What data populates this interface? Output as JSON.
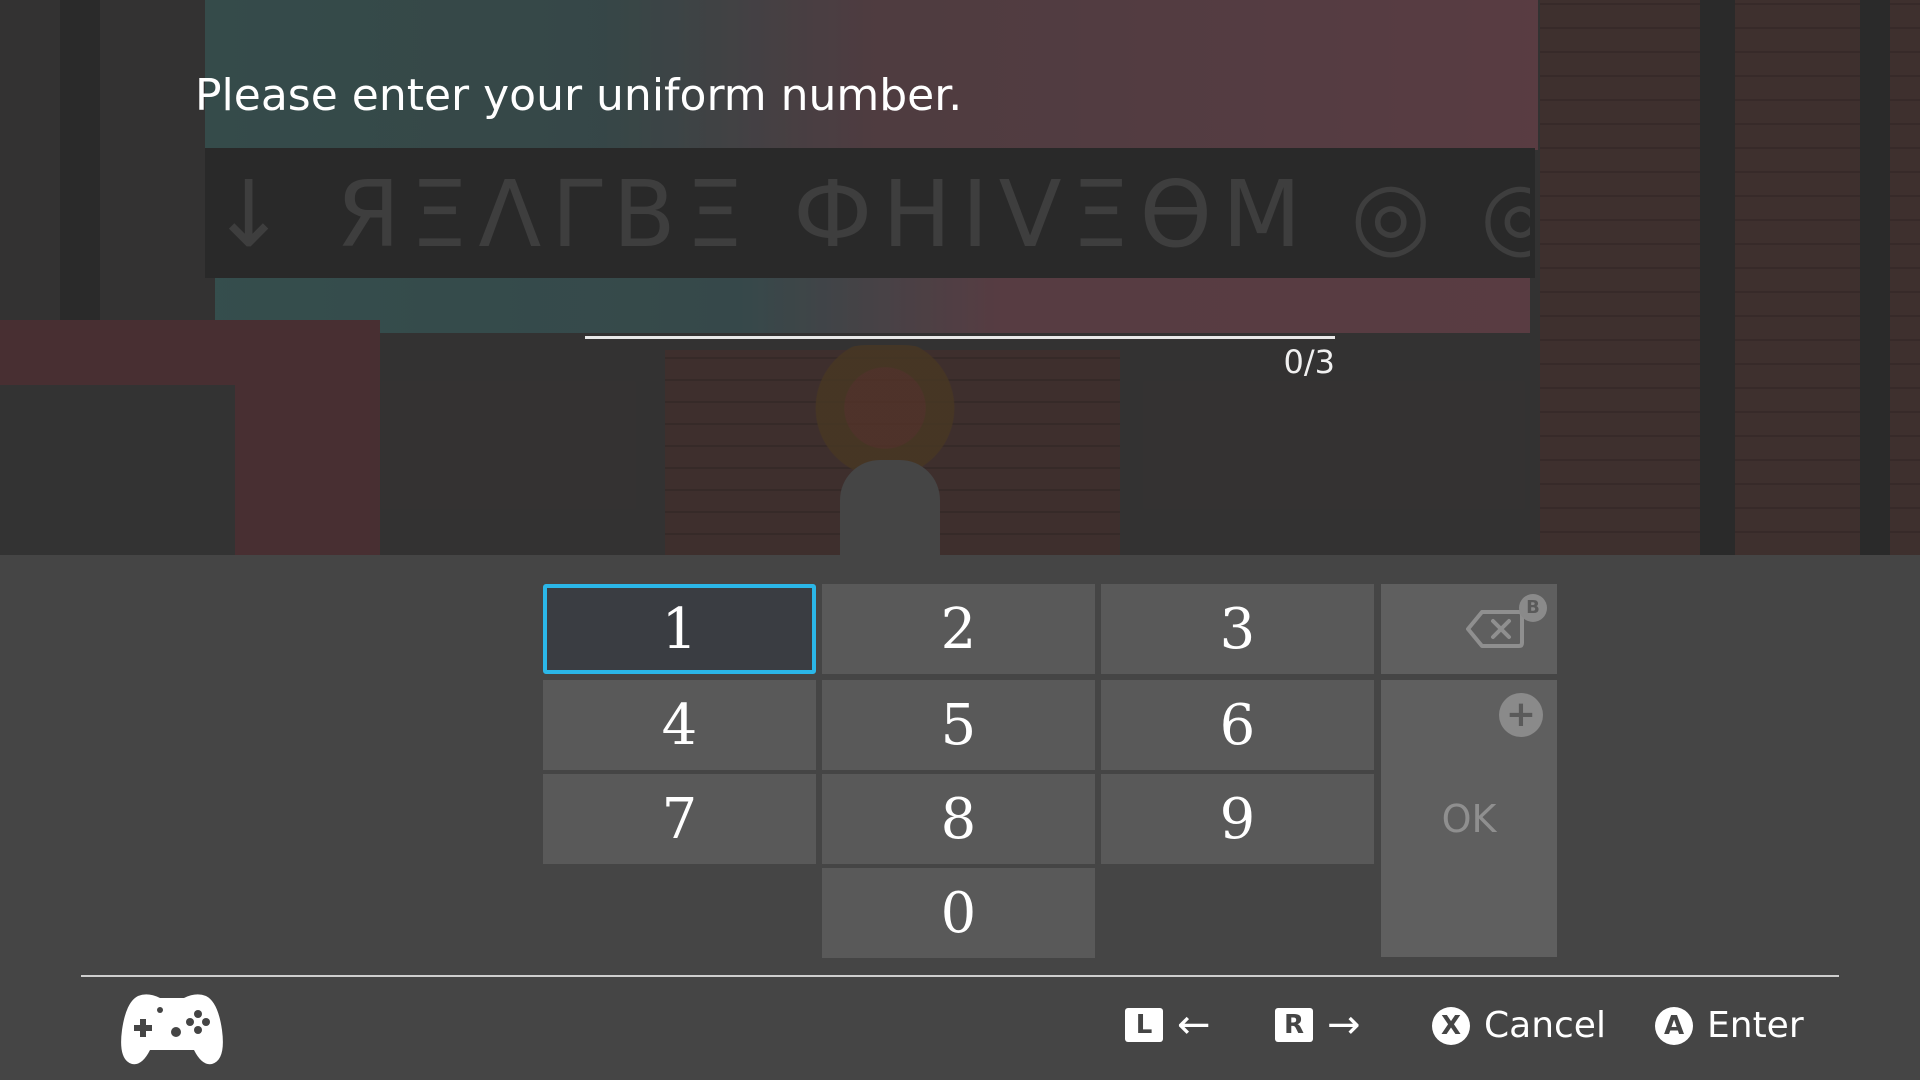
{
  "prompt": {
    "text": "Please enter your uniform number."
  },
  "input": {
    "value": "",
    "counter": "0/3"
  },
  "scene": {
    "sign_text": "↓ ЯΞΛΓΒΞ ФНIVΞѲM ◎ ◎ ?//"
  },
  "keypad": {
    "keys": [
      "1",
      "2",
      "3",
      "4",
      "5",
      "6",
      "7",
      "8",
      "9",
      "0"
    ],
    "selected": "1",
    "backspace_badge": "B",
    "ok_label": "OK",
    "ok_badge": "+"
  },
  "footer": {
    "left_button": "L",
    "left_arrow": "←",
    "right_button": "R",
    "right_arrow": "→",
    "cancel_button": "X",
    "cancel_label": "Cancel",
    "enter_button": "A",
    "enter_label": "Enter"
  },
  "colors": {
    "panel_bg": "#454545",
    "key_bg": "#595959",
    "selected_border": "#2bb7e8",
    "text": "#ffffff"
  }
}
